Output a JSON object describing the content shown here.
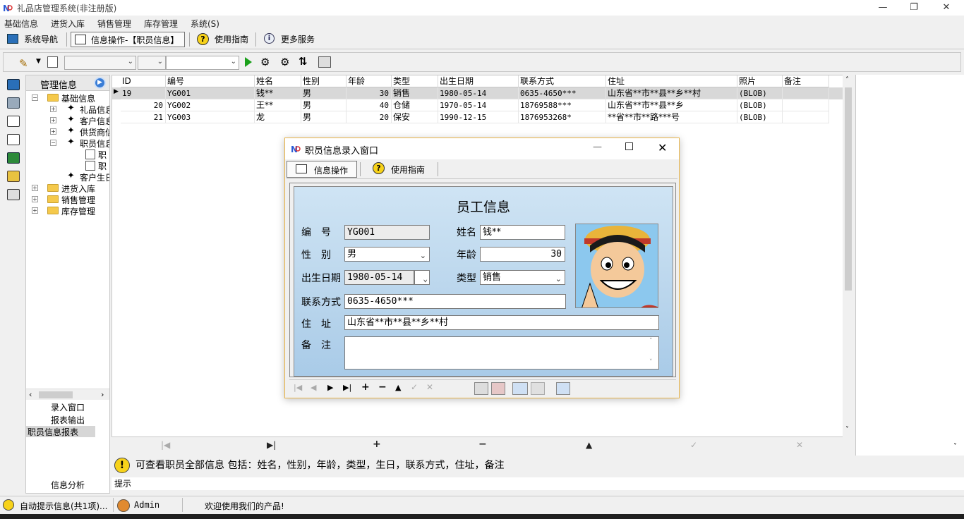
{
  "window": {
    "title": "礼品店管理系统(非注册版)"
  },
  "menu": [
    "基础信息",
    "进货入库",
    "销售管理",
    "库存管理",
    "系统(S)"
  ],
  "toolbar": {
    "nav": "系统导航",
    "active": "信息操作-【职员信息】",
    "guide": "使用指南",
    "more": "更多服务"
  },
  "tree": {
    "header": "管理信息",
    "items": [
      {
        "label": "基础信息",
        "level": 0,
        "type": "folder"
      },
      {
        "label": "礼品信息",
        "level": 1,
        "type": "node"
      },
      {
        "label": "客户信息",
        "level": 1,
        "type": "node"
      },
      {
        "label": "供货商信",
        "level": 1,
        "type": "node"
      },
      {
        "label": "职员信息",
        "level": 1,
        "type": "node"
      },
      {
        "label": "职",
        "level": 2,
        "type": "leaf"
      },
      {
        "label": "职",
        "level": 2,
        "type": "leaf"
      },
      {
        "label": "客户生日",
        "level": 1,
        "type": "node"
      },
      {
        "label": "进货入库",
        "level": 0,
        "type": "folder"
      },
      {
        "label": "销售管理",
        "level": 0,
        "type": "folder"
      },
      {
        "label": "库存管理",
        "level": 0,
        "type": "folder"
      }
    ],
    "lower": [
      "录入窗口",
      "报表输出",
      "职员信息报表"
    ],
    "analysis": "信息分析"
  },
  "grid": {
    "columns": [
      "ID",
      "编号",
      "姓名",
      "性别",
      "年龄",
      "类型",
      "出生日期",
      "联系方式",
      "住址",
      "照片",
      "备注"
    ],
    "rows": [
      [
        "19",
        "YG001",
        "钱**",
        "男",
        "30",
        "销售",
        "1980-05-14",
        "0635-4650***",
        "山东省**市**县**乡**村",
        "(BLOB)",
        ""
      ],
      [
        "20",
        "YG002",
        "王**",
        "男",
        "40",
        "仓储",
        "1970-05-14",
        "18769588***",
        "山东省**市**县**乡",
        "(BLOB)",
        ""
      ],
      [
        "21",
        "YG003",
        "龙",
        "男",
        "20",
        "保安",
        "1990-12-15",
        "1876953268*",
        "**省**市**路***号",
        "(BLOB)",
        ""
      ]
    ]
  },
  "hint": {
    "text": "可查看职员全部信息 包括：姓名，性别，年龄，类型，生日，联系方式，住址，备注",
    "label": "提示"
  },
  "status": {
    "auto": "自动提示信息(共1项)...",
    "user": "Admin",
    "welcome": "欢迎使用我们的产品!"
  },
  "dialog": {
    "title": "职员信息录入窗口",
    "tab_ops": "信息操作",
    "tab_guide": "使用指南",
    "form_title": "员工信息",
    "labels": {
      "id": "编　号",
      "name": "姓名",
      "gender": "性　别",
      "age": "年龄",
      "birth": "出生日期",
      "type": "类型",
      "contact": "联系方式",
      "address": "住　址",
      "remark": "备　注"
    },
    "values": {
      "id": "YG001",
      "name": "钱**",
      "gender": "男",
      "age": "30",
      "birth": "1980-05-14",
      "type": "销售",
      "contact": "0635-4650***",
      "address": "山东省**市**县**乡**村",
      "remark": ""
    }
  },
  "colors": {
    "accent": "#e8b44a",
    "form_bg": "#bcd7ee",
    "selected_row": "#d8d8d8"
  }
}
